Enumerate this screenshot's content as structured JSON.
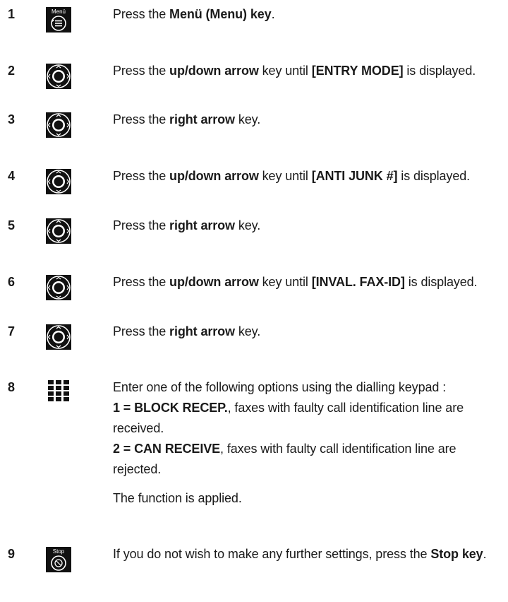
{
  "steps": [
    {
      "num": "1",
      "icon": "menu-key-icon",
      "icon_label": "Menü",
      "parts": [
        {
          "t": "Press the "
        },
        {
          "t": "Menü (Menu) key",
          "b": true
        },
        {
          "t": "."
        }
      ]
    },
    {
      "num": "2",
      "icon": "navigation-key-icon",
      "parts": [
        {
          "t": "Press the "
        },
        {
          "t": "up/down arrow",
          "b": true
        },
        {
          "t": " key until "
        },
        {
          "t": "[ENTRY MODE]",
          "b": true
        },
        {
          "t": " is displayed."
        }
      ]
    },
    {
      "num": "3",
      "icon": "navigation-key-icon",
      "parts": [
        {
          "t": "Press the "
        },
        {
          "t": "right arrow",
          "b": true
        },
        {
          "t": " key."
        }
      ]
    },
    {
      "num": "4",
      "icon": "navigation-key-icon",
      "parts": [
        {
          "t": "Press the "
        },
        {
          "t": "up/down arrow",
          "b": true
        },
        {
          "t": " key until "
        },
        {
          "t": "[ANTI JUNK #]",
          "b": true
        },
        {
          "t": " is displayed."
        }
      ]
    },
    {
      "num": "5",
      "icon": "navigation-key-icon",
      "parts": [
        {
          "t": "Press the "
        },
        {
          "t": "right arrow",
          "b": true
        },
        {
          "t": " key."
        }
      ]
    },
    {
      "num": "6",
      "icon": "navigation-key-icon",
      "parts": [
        {
          "t": "Press the "
        },
        {
          "t": "up/down arrow",
          "b": true
        },
        {
          "t": " key until "
        },
        {
          "t": "[INVAL. FAX-ID]",
          "b": true
        },
        {
          "t": " is displayed."
        }
      ]
    },
    {
      "num": "7",
      "icon": "navigation-key-icon",
      "parts": [
        {
          "t": "Press the "
        },
        {
          "t": "right arrow",
          "b": true
        },
        {
          "t": " key."
        }
      ]
    },
    {
      "num": "8",
      "icon": "dialling-keypad-icon",
      "parts": [
        {
          "t": "Enter one of the following options using the dialling keypad :"
        }
      ],
      "extra": [
        [
          {
            "t": "1 = BLOCK RECEP.",
            "b": true
          },
          {
            "t": ", faxes with faulty call identification line are received."
          }
        ],
        [
          {
            "t": "2 = CAN RECEIVE",
            "b": true
          },
          {
            "t": ", faxes with faulty call identification line are rejected."
          }
        ]
      ],
      "note": "The function is applied."
    },
    {
      "num": "9",
      "icon": "stop-key-icon",
      "icon_label": "Stop",
      "parts": [
        {
          "t": "If you do not wish to make any further settings, press the "
        },
        {
          "t": "Stop key",
          "b": true
        },
        {
          "t": "."
        }
      ]
    }
  ]
}
